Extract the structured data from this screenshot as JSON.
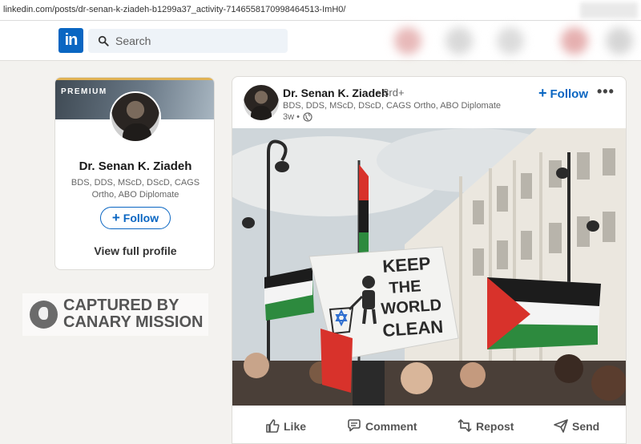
{
  "browser": {
    "url": "linkedin.com/posts/dr-senan-k-ziadeh-b1299a37_activity-7146558170998464513-ImH0/"
  },
  "nav": {
    "logo_text": "in",
    "search_placeholder": "Search",
    "brand_color": "#0a66c2"
  },
  "profile_card": {
    "badge": "PREMIUM",
    "name": "Dr. Senan K. Ziadeh",
    "credentials": "BDS, DDS, MScD, DScD, CAGS Ortho, ABO Diplomate",
    "follow_label": "Follow",
    "view_profile_label": "View full profile"
  },
  "watermark": {
    "line1": "CAPTURED BY",
    "line2": "CANARY MISSION"
  },
  "post": {
    "author": "Dr. Senan K. Ziadeh",
    "degree": "• 3rd+",
    "headline": "BDS, DDS, MScD, DScD, CAGS Ortho, ABO Diplomate",
    "time": "3w •",
    "follow_label": "Follow",
    "more": "•••",
    "sign": {
      "line1": "KEEP",
      "line2": "THE",
      "line3": "WORLD",
      "line4": "CLEAN"
    }
  },
  "actions": {
    "like": "Like",
    "comment": "Comment",
    "repost": "Repost",
    "send": "Send"
  }
}
